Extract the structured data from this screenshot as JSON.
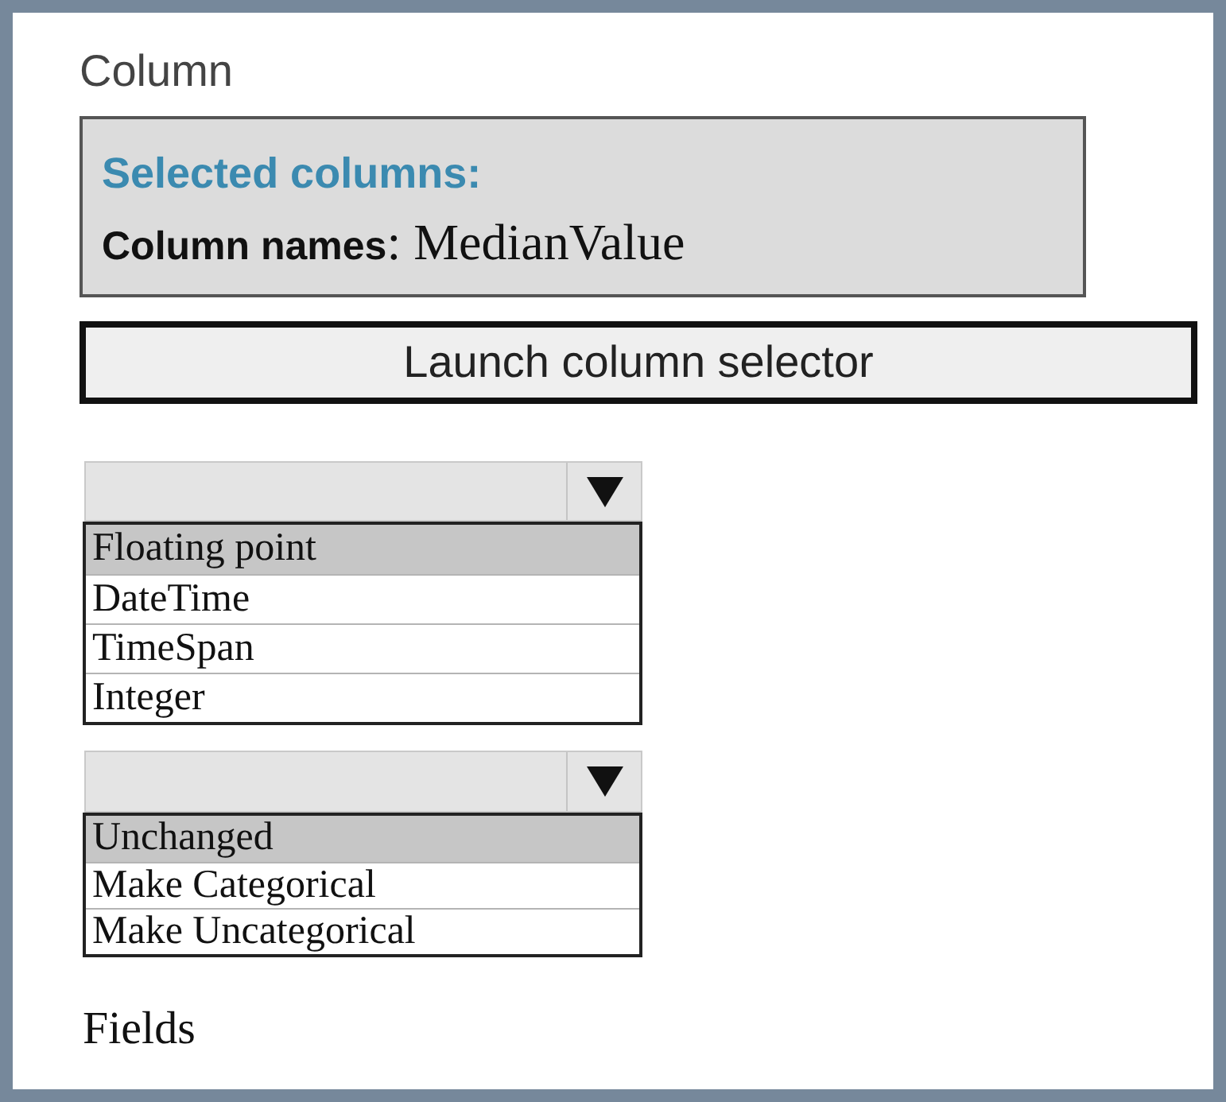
{
  "section_label": "Column",
  "selected_columns": {
    "title": "Selected columns:",
    "names": "**Column names**: MedianValue"
  },
  "launch_button": {
    "label": "Launch column selector"
  },
  "dropdowns": [
    {
      "options": [
        {
          "label": "Floating point",
          "selected": true
        },
        {
          "label": "DateTime",
          "selected": false
        },
        {
          "label": "TimeSpan",
          "selected": false
        },
        {
          "label": "Integer",
          "selected": false
        }
      ]
    },
    {
      "options": [
        {
          "label": "Unchanged",
          "selected": true
        },
        {
          "label": "Make Categorical",
          "selected": false
        },
        {
          "label": "Make Uncategorical",
          "selected": false
        }
      ]
    }
  ],
  "footer_label": "Fields"
}
